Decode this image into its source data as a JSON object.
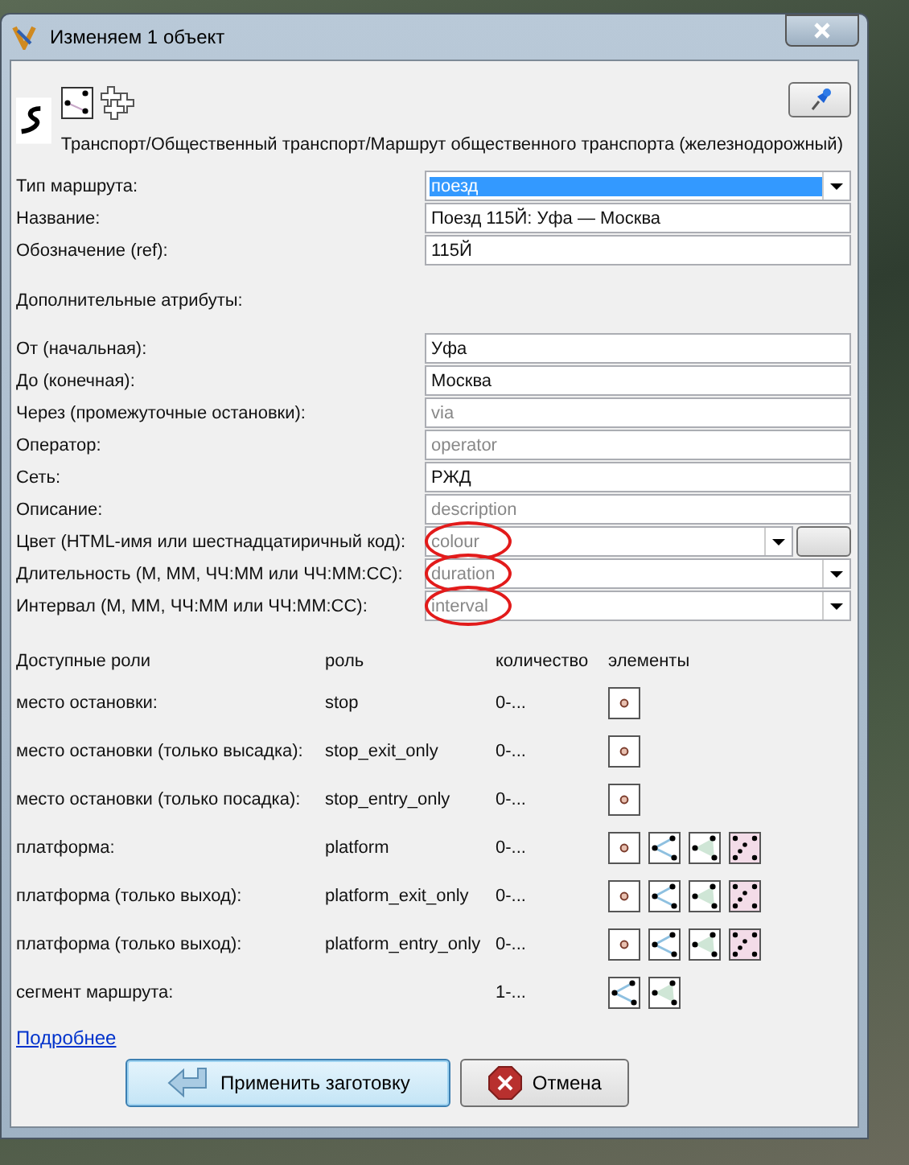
{
  "window": {
    "title": "Изменяем 1 объект"
  },
  "preset": {
    "path": "Транспорт/Общественный транспорт/Маршрут общественного транспорта (железнодорожный)",
    "types": [
      {
        "kind": "way"
      },
      {
        "kind": "relation"
      }
    ]
  },
  "fields": [
    {
      "kind": "combo",
      "label": "Тип маршрута:",
      "value": "поезд",
      "text_selected": true
    },
    {
      "kind": "text",
      "label": "Название:",
      "value": "Поезд 115Й: Уфа — Москва",
      "text_selected": false
    },
    {
      "kind": "text",
      "label": "Обозначение (ref):",
      "value": "115Й",
      "text_selected": false
    }
  ],
  "section": "Дополнительные атрибуты:",
  "extra_fields": [
    {
      "kind": "text",
      "label": "От (начальная):",
      "value": "Уфа",
      "circled": false
    },
    {
      "kind": "text",
      "label": "До (конечная):",
      "value": "Москва",
      "circled": false
    },
    {
      "kind": "text",
      "label": "Через (промежуточные остановки):",
      "placeholder": "via",
      "circled": false
    },
    {
      "kind": "text",
      "label": "Оператор:",
      "placeholder": "operator",
      "circled": false
    },
    {
      "kind": "text",
      "label": "Сеть:",
      "value": "РЖД",
      "circled": false
    },
    {
      "kind": "text",
      "label": "Описание:",
      "placeholder": "description",
      "circled": false
    },
    {
      "kind": "color",
      "label": "Цвет (HTML-имя или шестнадцатиричный код):",
      "placeholder": "colour",
      "circled": true
    },
    {
      "kind": "combo",
      "label": "Длительность (М, ММ, ЧЧ:ММ или ЧЧ:ММ:СС):",
      "placeholder": "duration",
      "circled": true
    },
    {
      "kind": "combo",
      "label": "Интервал (М, ММ, ЧЧ:ММ или ЧЧ:ММ:СС):",
      "placeholder": "interval",
      "circled": true
    }
  ],
  "roles": {
    "columns": [
      "Доступные роли",
      "роль",
      "количество",
      "элементы"
    ],
    "rows": [
      {
        "label": "место остановки:",
        "role": "stop",
        "count": "0-...",
        "elements": [
          {
            "kind": "node"
          }
        ]
      },
      {
        "label": "место остановки (только высадка):",
        "role": "stop_exit_only",
        "count": "0-...",
        "elements": [
          {
            "kind": "node"
          }
        ]
      },
      {
        "label": "место остановки (только посадка):",
        "role": "stop_entry_only",
        "count": "0-...",
        "elements": [
          {
            "kind": "node"
          }
        ]
      },
      {
        "label": "платформа:",
        "role": "platform",
        "count": "0-...",
        "elements": [
          {
            "kind": "node"
          },
          {
            "kind": "way"
          },
          {
            "kind": "area"
          },
          {
            "kind": "relation"
          }
        ]
      },
      {
        "label": "платформа (только выход):",
        "role": "platform_exit_only",
        "count": "0-...",
        "elements": [
          {
            "kind": "node"
          },
          {
            "kind": "way"
          },
          {
            "kind": "area"
          },
          {
            "kind": "relation"
          }
        ]
      },
      {
        "label": "платформа (только выход):",
        "role": "platform_entry_only",
        "count": "0-...",
        "elements": [
          {
            "kind": "node"
          },
          {
            "kind": "way"
          },
          {
            "kind": "area"
          },
          {
            "kind": "relation"
          }
        ]
      },
      {
        "label": "сегмент маршрута:",
        "count": "1-...",
        "elements": [
          {
            "kind": "way"
          },
          {
            "kind": "area"
          }
        ]
      }
    ]
  },
  "link": "Подробнее",
  "buttons": [
    {
      "kind": "apply",
      "label": "Применить заготовку"
    },
    {
      "kind": "cancel",
      "label": "Отмена"
    }
  ]
}
